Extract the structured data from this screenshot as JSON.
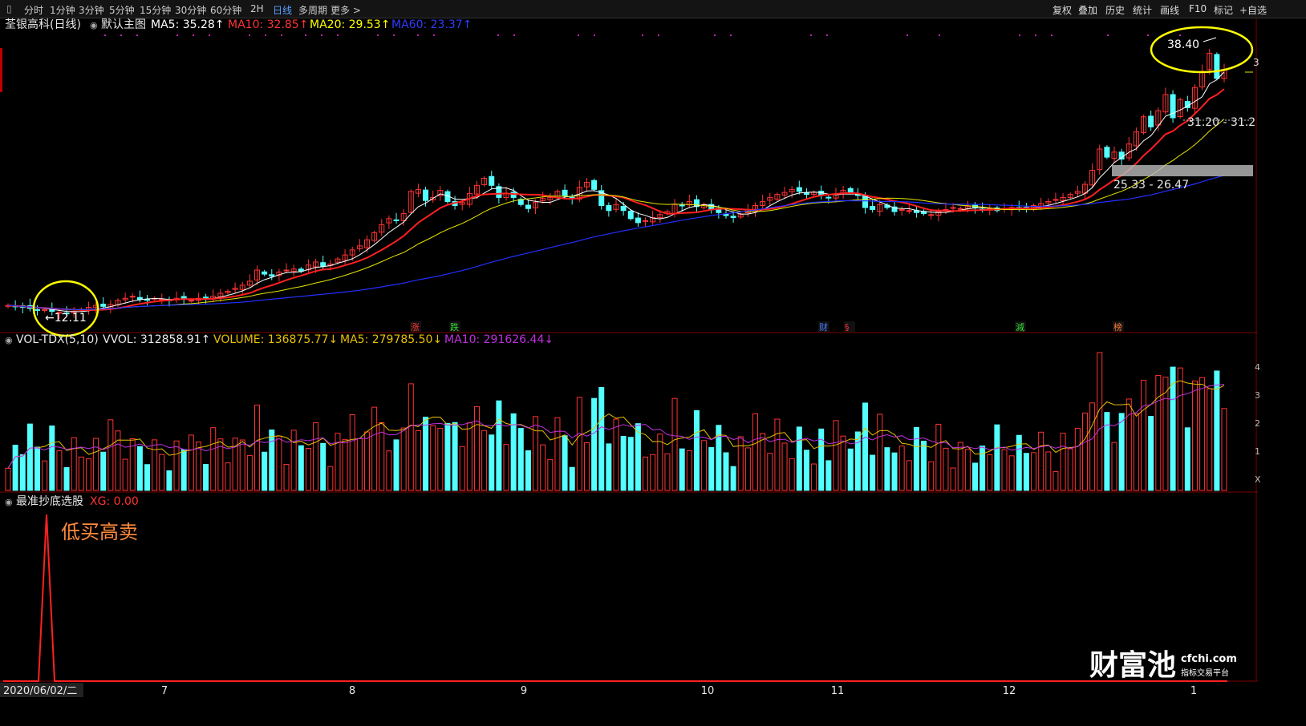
{
  "toolbar": {
    "periods": [
      "分时",
      "1分钟",
      "3分钟",
      "5分钟",
      "15分钟",
      "30分钟",
      "60分钟",
      "2H",
      "日线",
      "多周期",
      "更多 >"
    ],
    "active_period": "日线",
    "actions": [
      "复权",
      "叠加",
      "历史",
      "统计",
      "画线",
      "F10",
      "标记",
      "+自选"
    ]
  },
  "main_panel": {
    "title": "荃银高科(日线)",
    "template": "默认主图",
    "ma_values": [
      {
        "label": "MA5: 35.28",
        "color": "#ffffff"
      },
      {
        "label": "MA10: 32.85",
        "color": "#ff3333"
      },
      {
        "label": "MA20: 29.53",
        "color": "#ffff00"
      },
      {
        "label": "MA60: 23.37",
        "color": "#2f3bff"
      }
    ],
    "high_label": "38.40",
    "low_label": "12.11",
    "zone_label_upper": "31.20 - 31.2",
    "zone_label_lower": "25.33 - 26.47",
    "right_edge_label": "3",
    "event_markers": [
      {
        "text": "涨",
        "color": "#ff3333"
      },
      {
        "text": "跌",
        "color": "#33dd33"
      },
      {
        "text": "财",
        "color": "#4a7bff"
      },
      {
        "text": "§",
        "color": "#ff3333"
      },
      {
        "text": "減",
        "color": "#33dd33"
      },
      {
        "text": "榜",
        "color": "#ff7a3a"
      }
    ]
  },
  "volume_panel": {
    "title": "VOL-TDX(5,10)",
    "vvol": "VVOL: 312858.91",
    "volume": "VOLUME: 136875.77",
    "ma5": "MA5: 279785.50",
    "ma10": "MA10: 291626.44",
    "axis_labels": [
      "4",
      "3",
      "2",
      "1",
      "X"
    ]
  },
  "indicator_panel": {
    "title": "最准抄底选股",
    "xg": "XG: 0.00",
    "annotation": "低买高卖"
  },
  "x_axis": {
    "start_date": "2020/06/02/二",
    "months": [
      "7",
      "8",
      "9",
      "10",
      "11",
      "12",
      "1"
    ]
  },
  "watermark": {
    "brand": "财富池",
    "domain": "cfchi.com",
    "tagline": "指标交易平台"
  },
  "colors": {
    "up": "#ff3333",
    "down": "#54ffff",
    "ma5": "#ffffff",
    "ma10": "#ff2020",
    "ma20": "#e6e600",
    "ma60": "#2230ff",
    "vol_ma5": "#e6c000",
    "vol_ma10": "#c030e0",
    "highlight_circle": "#ffff00"
  },
  "chart_data": {
    "type": "candlestick",
    "date_range": [
      "2020/06/02",
      "2021/01"
    ],
    "price_range": [
      12.11,
      38.4
    ],
    "closes": [
      12.9,
      12.8,
      12.7,
      12.6,
      12.4,
      12.5,
      12.3,
      12.2,
      12.11,
      12.3,
      12.5,
      12.7,
      12.9,
      12.8,
      13.0,
      13.4,
      13.6,
      13.8,
      13.5,
      13.4,
      13.6,
      13.5,
      13.4,
      13.6,
      13.5,
      13.4,
      13.6,
      13.7,
      13.8,
      14.1,
      14.3,
      14.6,
      14.9,
      15.3,
      16.4,
      16.0,
      15.8,
      16.2,
      16.4,
      16.5,
      16.3,
      16.9,
      17.2,
      16.8,
      17.0,
      17.5,
      17.9,
      18.4,
      18.8,
      19.4,
      20.1,
      20.9,
      21.5,
      21.3,
      22.0,
      24.2,
      24.4,
      23.3,
      23.6,
      24.3,
      23.2,
      22.8,
      23.1,
      24.0,
      24.8,
      25.5,
      24.8,
      23.6,
      24.0,
      23.6,
      22.9,
      22.5,
      23.1,
      23.5,
      23.6,
      24.2,
      23.8,
      23.5,
      24.6,
      25.1,
      24.4,
      22.8,
      22.3,
      22.9,
      22.3,
      21.5,
      21.1,
      21.3,
      21.6,
      21.9,
      22.2,
      22.9,
      22.8,
      23.2,
      22.7,
      22.9,
      22.4,
      22.1,
      21.8,
      21.6,
      21.9,
      22.4,
      22.8,
      23.2,
      23.6,
      23.9,
      24.1,
      24.4,
      24.2,
      23.9,
      24.1,
      23.8,
      23.6,
      23.9,
      24.3,
      24.1,
      23.8,
      22.6,
      22.4,
      22.9,
      22.6,
      22.2,
      22.4,
      22.3,
      22.1,
      22.0,
      21.9,
      22.2,
      22.4,
      22.6,
      22.5,
      22.7,
      22.6,
      22.4,
      22.5,
      22.3,
      22.5,
      22.6,
      22.5,
      22.6,
      22.8,
      23.0,
      23.2,
      23.4,
      23.6,
      23.9,
      24.2,
      24.9,
      26.3,
      28.4,
      27.6,
      28.1,
      27.4,
      28.9,
      30.1,
      31.6,
      30.6,
      32.2,
      33.8,
      31.5,
      33.3,
      32.5,
      34.5,
      36.1,
      37.9,
      35.4,
      36.3
    ],
    "vma5_last": 279785.5,
    "vma10_last": 291626.44,
    "volume_last": 136875.77
  }
}
